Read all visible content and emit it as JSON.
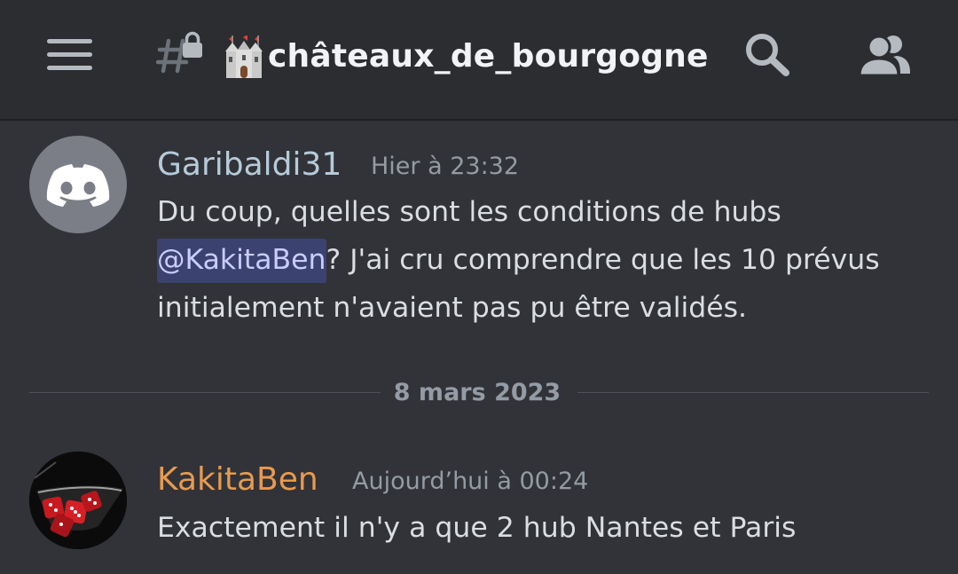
{
  "header": {
    "channel_icon": "hash-lock-icon",
    "channel_emoji": "castle-emoji",
    "channel_name": "château­x_de_bourgogne",
    "menu_icon": "hamburger-menu-icon",
    "search_icon": "search-icon",
    "members_icon": "members-icon"
  },
  "messages": [
    {
      "author": "Garibaldi31",
      "author_color": "#b6cbd9",
      "timestamp": "Hier à 23:32",
      "avatar_icon": "discord-logo-icon",
      "line1": "Du coup, quelles sont les conditions de hubs",
      "mention": "@KakitaBen",
      "line2_rest": "? J'ai cru comprendre que les 10 prévus",
      "line3": "initialement n'avaient pas pu être validés."
    },
    {
      "author": "KakitaBen",
      "author_color": "#e89a4f",
      "timestamp": "Aujourd’hui à 00:24",
      "avatar_icon": "dice-glass-avatar",
      "text": "Exactement il n'y a que 2 hub Nantes et Paris"
    }
  ],
  "date_divider": "8 mars 2023",
  "colors": {
    "background": "#313338",
    "header_background": "#2b2d31",
    "mention_background": "#3c4270",
    "mention_text": "#c9cdfb"
  }
}
